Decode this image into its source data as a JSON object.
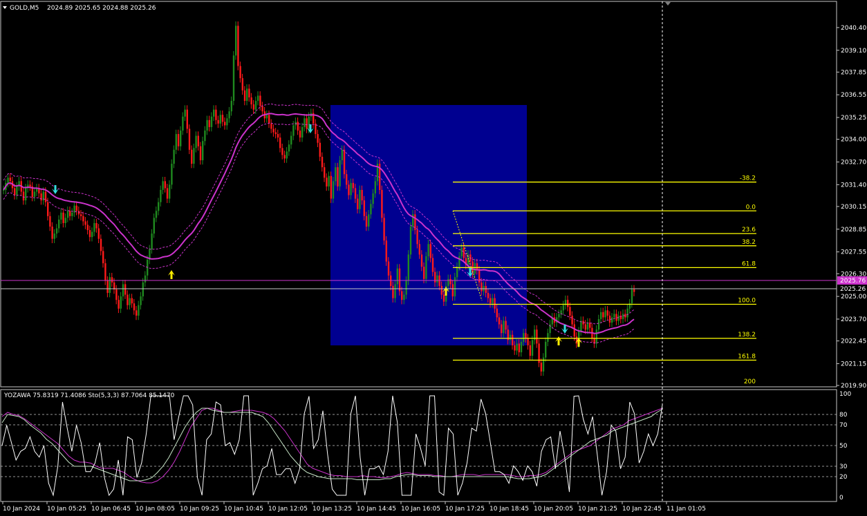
{
  "header": {
    "symbol": "GOLD,M5",
    "ohlc": "2024.89 2025.65 2024.88 2025.26"
  },
  "indicator": {
    "label": "YOZAWA 75.8319 71.4086  Sto(5,3,3) 87.7064 85.1470",
    "levels": [
      "100",
      "80",
      "70",
      "50",
      "30",
      "20",
      "0"
    ]
  },
  "price_axis": {
    "ticks": [
      "2040.40",
      "2039.10",
      "2037.85",
      "2036.55",
      "2035.25",
      "2034.00",
      "2032.70",
      "2031.40",
      "2030.15",
      "2028.85",
      "2027.55",
      "2026.30",
      "2025.00",
      "2023.70",
      "2022.45",
      "2021.15",
      "2019.90"
    ],
    "current_bid": "2025.76",
    "current_ask": "2025.26"
  },
  "time_axis": {
    "ticks": [
      "10 Jan 2024",
      "10 Jan 05:25",
      "10 Jan 06:45",
      "10 Jan 08:05",
      "10 Jan 09:25",
      "10 Jan 10:45",
      "10 Jan 12:05",
      "10 Jan 13:25",
      "10 Jan 14:45",
      "10 Jan 16:05",
      "10 Jan 17:25",
      "10 Jan 18:45",
      "10 Jan 20:05",
      "10 Jan 21:25",
      "10 Jan 22:45",
      "11 Jan 01:05"
    ]
  },
  "fibonacci": {
    "levels": [
      {
        "label": "-38.2",
        "price": 2031.55
      },
      {
        "label": "0.0",
        "price": 2029.9
      },
      {
        "label": "23.6",
        "price": 2028.6
      },
      {
        "label": "38.2",
        "price": 2027.9
      },
      {
        "label": "61.8",
        "price": 2026.65
      },
      {
        "label": "100.0",
        "price": 2024.55
      },
      {
        "label": "138.2",
        "price": 2022.6
      },
      {
        "label": "161.8",
        "price": 2021.35
      },
      {
        "label": "200",
        "price": 2019.9
      }
    ]
  },
  "colors": {
    "background": "#000000",
    "bull": "#1f8a1f",
    "bear": "#ff1a1a",
    "ma": "#cc33cc",
    "fib": "#ffff00",
    "rect": "#000090",
    "arrow_down": "#33dddd",
    "arrow_up": "#ffee00",
    "bid_line": "#cc33cc",
    "ask_line": "#c8c8c8",
    "frame": "#c8c8c8"
  },
  "chart_data": {
    "type": "candlestick",
    "y_range": [
      2019.9,
      2040.95
    ],
    "indicator_range": [
      0,
      100
    ],
    "close": [
      2031.1,
      2031.5,
      2031.8,
      2031.6,
      2031.2,
      2030.8,
      2031.3,
      2031.6,
      2031.0,
      2030.5,
      2031.2,
      2031.4,
      2031.3,
      2030.7,
      2031.0,
      2031.2,
      2030.9,
      2030.5,
      2031.0,
      2030.4,
      2029.6,
      2029.0,
      2028.3,
      2028.6,
      2028.9,
      2029.4,
      2029.8,
      2029.2,
      2029.5,
      2029.9,
      2029.6,
      2029.8,
      2030.2,
      2029.9,
      2029.7,
      2029.6,
      2029.3,
      2029.1,
      2028.8,
      2028.4,
      2028.7,
      2029.2,
      2028.9,
      2028.3,
      2027.6,
      2026.9,
      2025.9,
      2025.2,
      2026.1,
      2025.8,
      2025.4,
      2024.8,
      2024.3,
      2025.0,
      2025.7,
      2025.1,
      2024.5,
      2024.9,
      2024.6,
      2024.2,
      2023.9,
      2024.5,
      2025.0,
      2025.8,
      2026.2,
      2027.1,
      2027.7,
      2028.6,
      2029.5,
      2029.9,
      2030.4,
      2031.1,
      2031.6,
      2031.2,
      2030.6,
      2031.4,
      2032.6,
      2033.4,
      2034.3,
      2033.6,
      2034.5,
      2035.3,
      2035.7,
      2034.6,
      2033.4,
      2032.6,
      2033.5,
      2034.2,
      2033.6,
      2032.8,
      2033.9,
      2034.5,
      2035.1,
      2034.7,
      2035.3,
      2035.7,
      2035.1,
      2034.9,
      2035.4,
      2035.0,
      2034.8,
      2035.2,
      2035.6,
      2036.2,
      2038.8,
      2040.5,
      2038.2,
      2037.5,
      2036.8,
      2036.2,
      2036.9,
      2036.4,
      2036.0,
      2035.7,
      2036.2,
      2036.5,
      2035.9,
      2035.6,
      2035.2,
      2035.4,
      2034.9,
      2034.6,
      2034.4,
      2034.3,
      2034.1,
      2033.5,
      2033.1,
      2032.9,
      2033.3,
      2033.7,
      2034.2,
      2034.8,
      2035.0,
      2034.5,
      2034.1,
      2034.7,
      2035.2,
      2034.6,
      2035.3,
      2035.5,
      2034.9,
      2034.3,
      2033.8,
      2033.0,
      2032.4,
      2031.8,
      2031.3,
      2031.9,
      2030.6,
      2031.6,
      2032.4,
      2031.3,
      2032.8,
      2033.4,
      2032.0,
      2031.4,
      2030.8,
      2031.5,
      2031.2,
      2030.6,
      2030.0,
      2031.1,
      2030.5,
      2029.6,
      2029.0,
      2029.7,
      2030.3,
      2030.9,
      2031.6,
      2032.6,
      2031.1,
      2029.5,
      2028.2,
      2027.0,
      2026.2,
      2025.6,
      2024.9,
      2025.7,
      2026.6,
      2025.3,
      2024.8,
      2025.1,
      2025.9,
      2027.4,
      2029.0,
      2029.7,
      2028.8,
      2028.0,
      2027.4,
      2026.7,
      2026.0,
      2027.3,
      2028.0,
      2027.2,
      2026.4,
      2025.8,
      2026.2,
      2025.6,
      2025.1,
      2024.7,
      2025.6,
      2026.0,
      2025.7,
      2025.0,
      2026.1,
      2026.7,
      2027.3,
      2027.8,
      2027.2,
      2026.8,
      2027.4,
      2027.0,
      2026.3,
      2026.9,
      2026.5,
      2025.8,
      2025.3,
      2025.6,
      2025.2,
      2024.9,
      2024.6,
      2024.9,
      2024.3,
      2023.8,
      2023.4,
      2022.9,
      2023.6,
      2023.1,
      2022.5,
      2022.8,
      2022.2,
      2021.9,
      2022.3,
      2021.8,
      2022.4,
      2022.9,
      2022.6,
      2022.2,
      2021.6,
      2022.5,
      2023.1,
      2022.3,
      2021.2,
      2020.7,
      2021.5,
      2022.4,
      2022.9,
      2023.4,
      2023.8,
      2023.5,
      2023.8,
      2024.0,
      2024.2,
      2024.5,
      2024.8,
      2024.4,
      2023.9,
      2023.4,
      2022.7,
      2022.3,
      2023.0,
      2023.6,
      2023.4,
      2023.1,
      2023.5,
      2023.2,
      2022.6,
      2022.3,
      2023.1,
      2023.7,
      2024.1,
      2023.8,
      2024.2,
      2023.9,
      2023.5,
      2023.8,
      2024.0,
      2023.6,
      2023.9,
      2023.7,
      2024.0,
      2023.8,
      2024.3,
      2024.6,
      2025.4,
      2025.26
    ],
    "yozawa": [
      78,
      82,
      80,
      79,
      76,
      72,
      68,
      64,
      60,
      56,
      52,
      46,
      40,
      36,
      34,
      34,
      33,
      30,
      28,
      28,
      28,
      26,
      24,
      20,
      17,
      15,
      14,
      14,
      16,
      20,
      26,
      34,
      44,
      56,
      68,
      76,
      84,
      86,
      86,
      84,
      82,
      82,
      83,
      84,
      84,
      84,
      83,
      82,
      80,
      76,
      70,
      64,
      56,
      48,
      40,
      32,
      28,
      26,
      24,
      22,
      21,
      21,
      20,
      20,
      20,
      21,
      20,
      20,
      19,
      19,
      20,
      21,
      23,
      24,
      23,
      22,
      22,
      22,
      21,
      21,
      20,
      20,
      21,
      22,
      22,
      22,
      21,
      22,
      22,
      22,
      22,
      22,
      21,
      20,
      20,
      21,
      21,
      22,
      24,
      28,
      32,
      36,
      40,
      44,
      46,
      48,
      50,
      54,
      58,
      62,
      66,
      68,
      70,
      74,
      76,
      78,
      80,
      82,
      84,
      86
    ],
    "stoch": [
      72,
      80,
      79,
      78,
      75,
      70,
      66,
      62,
      56,
      52,
      46,
      40,
      34,
      30,
      30,
      30,
      30,
      28,
      26,
      24,
      22,
      20,
      18,
      16,
      16,
      16,
      17,
      19,
      24,
      30,
      38,
      48,
      58,
      68,
      76,
      82,
      86,
      86,
      84,
      83,
      82,
      82,
      82,
      82,
      82,
      82,
      80,
      78,
      72,
      64,
      56,
      48,
      40,
      34,
      28,
      24,
      22,
      20,
      19,
      18,
      18,
      18,
      18,
      18,
      17,
      17,
      17,
      17,
      17,
      18,
      18,
      20,
      21,
      22,
      22,
      21,
      21,
      21,
      20,
      20,
      20,
      20,
      20,
      20,
      20,
      20,
      20,
      20,
      20,
      20,
      20,
      20,
      19,
      18,
      18,
      18,
      19,
      20,
      22,
      26,
      30,
      34,
      38,
      42,
      46,
      50,
      54,
      56,
      58,
      60,
      64,
      66,
      68,
      70,
      72,
      74,
      76,
      78,
      82,
      85
    ]
  }
}
